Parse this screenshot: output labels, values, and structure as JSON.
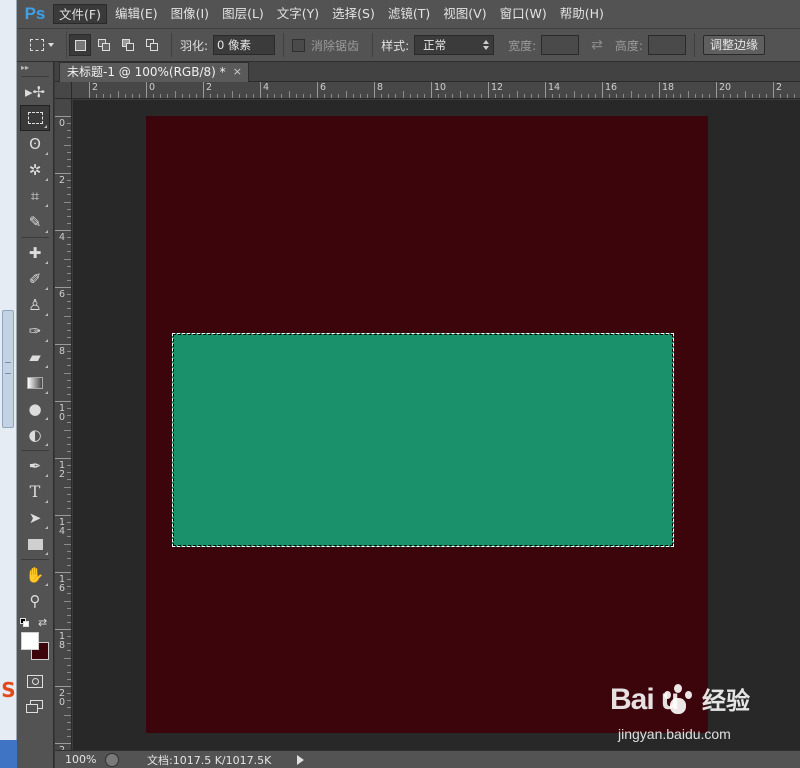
{
  "app": {
    "logo": "Ps"
  },
  "menu": [
    {
      "label": "文件(F)",
      "active": true
    },
    {
      "label": "编辑(E)"
    },
    {
      "label": "图像(I)"
    },
    {
      "label": "图层(L)"
    },
    {
      "label": "文字(Y)"
    },
    {
      "label": "选择(S)"
    },
    {
      "label": "滤镜(T)"
    },
    {
      "label": "视图(V)"
    },
    {
      "label": "窗口(W)"
    },
    {
      "label": "帮助(H)"
    }
  ],
  "options": {
    "feather_label": "羽化:",
    "feather_value": "0 像素",
    "antialias_label": "消除锯齿",
    "style_label": "样式:",
    "style_value": "正常",
    "width_label": "宽度:",
    "height_label": "高度:",
    "refine_edge_button": "调整边缘"
  },
  "document": {
    "tab_title": "未标题-1 @ 100%(RGB/8) *",
    "tab_close": "×",
    "background_color": "#3c050b",
    "selection_fill": "#1a916b"
  },
  "rulers": {
    "top_labels": [
      "2",
      "0",
      "2",
      "4",
      "6",
      "8",
      "10",
      "12",
      "14",
      "16",
      "18",
      "20",
      "2"
    ],
    "left_labels": [
      "0",
      "2",
      "4",
      "6",
      "8",
      "10",
      "12",
      "14",
      "16",
      "18",
      "20",
      "2"
    ]
  },
  "colors": {
    "foreground": "#ffffff",
    "background": "#3c050b"
  },
  "status": {
    "zoom": "100%",
    "doc_size": "文档:1017.5 K/1017.5K"
  },
  "watermark": {
    "brand": "Bai  u",
    "cn": "经验",
    "url": "jingyan.baidu.com"
  }
}
